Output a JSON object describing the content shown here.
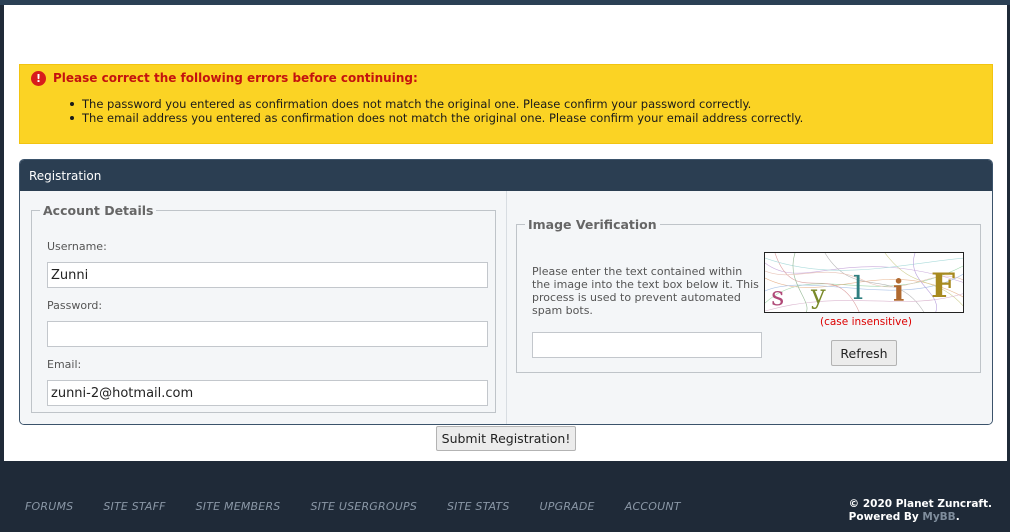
{
  "errors": {
    "title": "Please correct the following errors before continuing:",
    "items": [
      "The password you entered as confirmation does not match the original one. Please confirm your password correctly.",
      "The email address you entered as confirmation does not match the original one. Please confirm your email address correctly."
    ],
    "icon": "exclamation-circle-icon",
    "color": "#c4120f",
    "background": "#fbd324"
  },
  "registration": {
    "title": "Registration",
    "account": {
      "legend": "Account Details",
      "username_label": "Username:",
      "username_value": "Zunni",
      "password_label": "Password:",
      "password_value": "",
      "email_label": "Email:",
      "email_value": "zunni-2@hotmail.com"
    },
    "verification": {
      "legend": "Image Verification",
      "instructions": "Please enter the text contained within the image into the text box below it. This process is used to prevent automated spam bots.",
      "captcha_text": "sylif",
      "input_value": "",
      "case_note": "(case insensitive)",
      "refresh_label": "Refresh"
    },
    "submit_label": "Submit Registration!"
  },
  "footer": {
    "nav": [
      "FORUMS",
      "SITE STAFF",
      "SITE MEMBERS",
      "SITE USERGROUPS",
      "SITE STATS",
      "UPGRADE",
      "ACCOUNT"
    ],
    "copyright": "© 2020 Planet Zuncraft.",
    "powered_prefix": "Powered By ",
    "powered_brand": "MyBB",
    "powered_suffix": "."
  },
  "colors": {
    "header_bg": "#2b3e52",
    "footer_bg": "#1f2a38",
    "error_red": "#d81c1c"
  }
}
